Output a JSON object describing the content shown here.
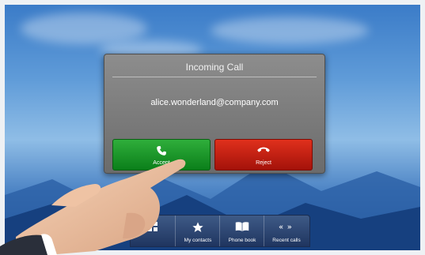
{
  "dialog": {
    "title": "Incoming Call",
    "caller": "alice.wonderland@company.com",
    "accept_label": "Accept",
    "reject_label": "Reject"
  },
  "toolbar": {
    "items": [
      {
        "label": "",
        "icon": "grid-icon"
      },
      {
        "label": "My contacts",
        "icon": "star-icon"
      },
      {
        "label": "Phone book",
        "icon": "book-icon"
      },
      {
        "label": "Recent calls",
        "icon": "recent-calls-icon"
      }
    ]
  },
  "colors": {
    "accept": "#1a9a2a",
    "reject": "#c7200f",
    "dialog": "#7b7b7b",
    "toolbar": "#2d4673"
  }
}
